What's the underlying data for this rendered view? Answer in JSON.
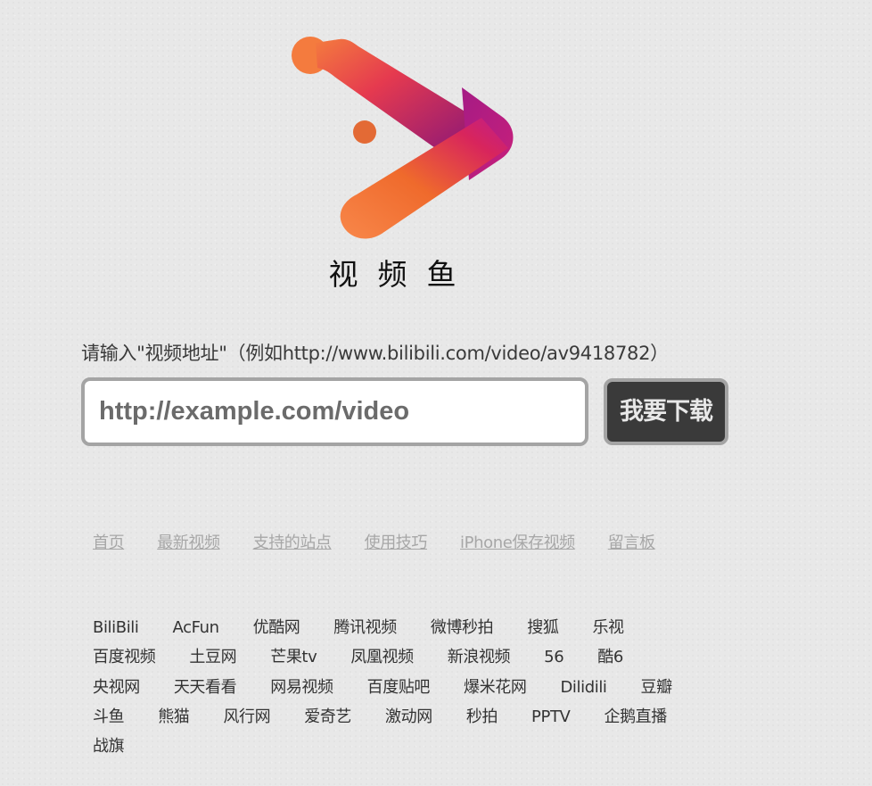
{
  "brand": {
    "name": "视频鱼",
    "logo_icon": "play-triangle-fish-icon",
    "colors": {
      "orange": "#f47b3e",
      "red": "#e53a4f",
      "magenta": "#c01d8a",
      "purple": "#5d1679"
    }
  },
  "search": {
    "prompt": "请输入\"视频地址\"（例如http://www.bilibili.com/video/av9418782）",
    "placeholder": "http://example.com/video",
    "value": "",
    "button_label": "我要下载"
  },
  "nav": {
    "items": [
      "首页",
      "最新视频",
      "支持的站点",
      "使用技巧",
      "iPhone保存视频",
      "留言板"
    ]
  },
  "sites": {
    "items": [
      "BiliBili",
      "AcFun",
      "优酷网",
      "腾讯视频",
      "微博秒拍",
      "搜狐",
      "乐视",
      "百度视频",
      "土豆网",
      "芒果tv",
      "凤凰视频",
      "新浪视频",
      "56",
      "酷6",
      "央视网",
      "天天看看",
      "网易视频",
      "百度贴吧",
      "爆米花网",
      "Dilidili",
      "豆瓣",
      "斗鱼",
      "熊猫",
      "风行网",
      "爱奇艺",
      "激动网",
      "秒拍",
      "PPTV",
      "企鹅直播",
      "战旗"
    ]
  }
}
